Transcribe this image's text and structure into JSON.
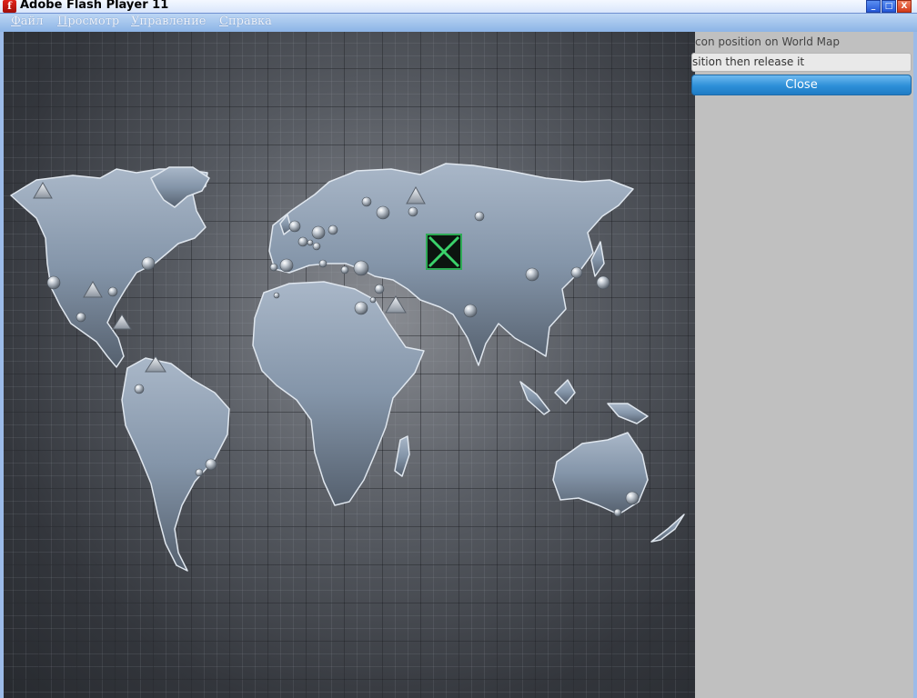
{
  "window": {
    "title": "Adobe Flash Player 11",
    "app_icon": "flash-logo",
    "controls": [
      "_",
      "□",
      "X"
    ]
  },
  "menubar": {
    "items": [
      "Файл",
      "Просмотр",
      "Управление",
      "Справка"
    ]
  },
  "panel": {
    "instruction": "con position on World Map",
    "hint": "sition then release it",
    "close_label": "Close"
  },
  "map": {
    "description_icon": "world-map",
    "markers": {
      "spheres": 34,
      "triangles": 7
    },
    "selected_marker_icon": "x-marker-icon",
    "colors": {
      "continent": "#8d9db0",
      "background": "#3a3d43",
      "selected_marker_border": "#3ad26a"
    }
  }
}
